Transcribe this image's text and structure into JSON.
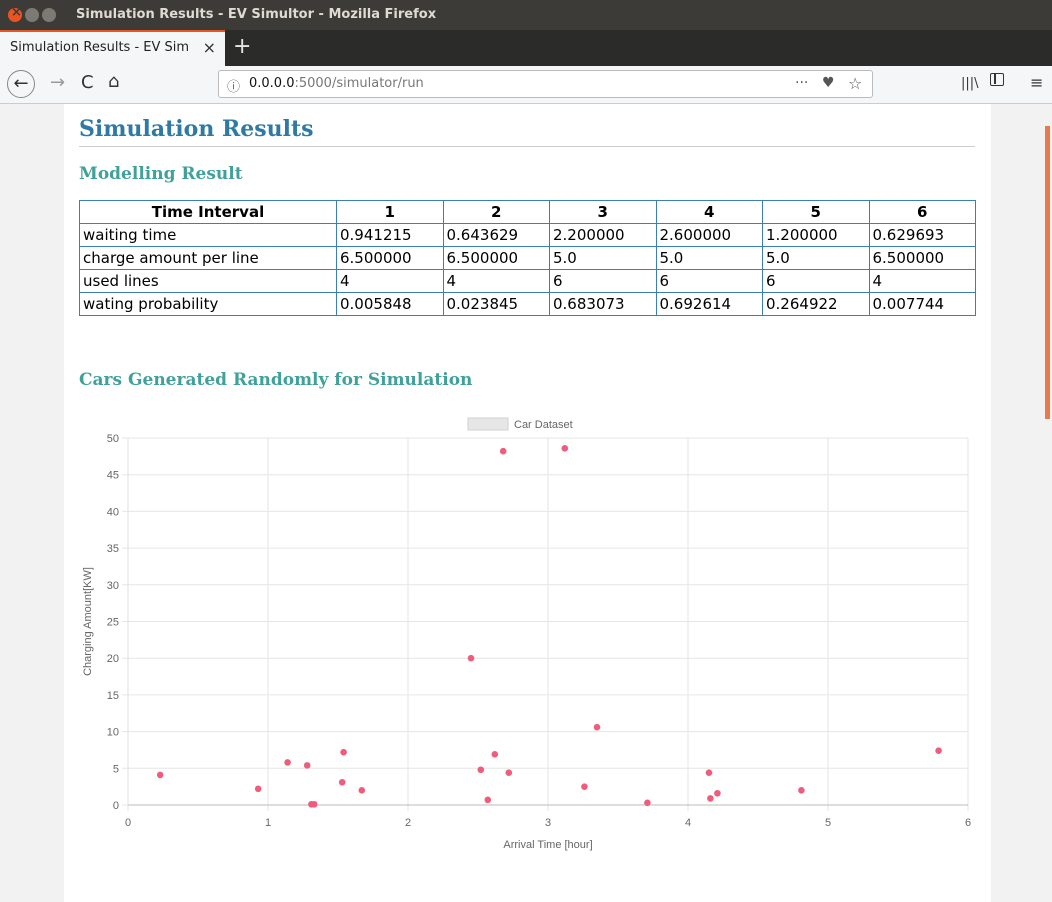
{
  "window": {
    "title": "Simulation Results - EV Simultor - Mozilla Firefox"
  },
  "tab": {
    "title": "Simulation Results - EV Sim",
    "close": "×",
    "new_tab": "+"
  },
  "nav": {
    "back": "←",
    "forward": "→",
    "reload": "C",
    "home": "⌂",
    "url_host": "0.0.0.0",
    "url_path": ":5000/simulator/run",
    "info_icon": "ⓘ",
    "more": "···",
    "pocket": "♥",
    "star": "☆",
    "library": "|||\\",
    "menu": "≡"
  },
  "page": {
    "title": "Simulation Results",
    "modelling_heading": "Modelling Result",
    "cars_heading": "Cars Generated Randomly for Simulation"
  },
  "table": {
    "headers": [
      "Time Interval",
      "1",
      "2",
      "3",
      "4",
      "5",
      "6"
    ],
    "rows": [
      [
        "waiting time",
        "0.941215",
        "0.643629",
        "2.200000",
        "2.600000",
        "1.200000",
        "0.629693"
      ],
      [
        "charge amount per line",
        "6.500000",
        "6.500000",
        "5.0",
        "5.0",
        "5.0",
        "6.500000"
      ],
      [
        "used lines",
        "4",
        "4",
        "6",
        "6",
        "6",
        "4"
      ],
      [
        "wating probability",
        "0.005848",
        "0.023845",
        "0.683073",
        "0.692614",
        "0.264922",
        "0.007744"
      ]
    ]
  },
  "chart_data": {
    "type": "scatter",
    "legend": "Car Dataset",
    "xlabel": "Arrival Time [hour]",
    "ylabel": "Charging Amount[KW]",
    "xlim": [
      0,
      6
    ],
    "ylim": [
      0,
      50
    ],
    "x_ticks": [
      0,
      1,
      2,
      3,
      4,
      5,
      6
    ],
    "y_ticks": [
      0,
      5,
      10,
      15,
      20,
      25,
      30,
      35,
      40,
      45,
      50
    ],
    "grid": true,
    "legend_position": "top",
    "point_color": "#ef5d7d",
    "points": [
      {
        "x": 0.23,
        "y": 4.1
      },
      {
        "x": 0.93,
        "y": 2.2
      },
      {
        "x": 1.14,
        "y": 5.8
      },
      {
        "x": 1.28,
        "y": 5.4
      },
      {
        "x": 1.31,
        "y": 0.1
      },
      {
        "x": 1.33,
        "y": 0.1
      },
      {
        "x": 1.53,
        "y": 3.1
      },
      {
        "x": 1.54,
        "y": 7.2
      },
      {
        "x": 1.67,
        "y": 2.0
      },
      {
        "x": 2.45,
        "y": 20.0
      },
      {
        "x": 2.52,
        "y": 4.8
      },
      {
        "x": 2.57,
        "y": 0.7
      },
      {
        "x": 2.62,
        "y": 6.9
      },
      {
        "x": 2.68,
        "y": 48.2
      },
      {
        "x": 2.72,
        "y": 4.4
      },
      {
        "x": 3.12,
        "y": 48.6
      },
      {
        "x": 3.26,
        "y": 2.5
      },
      {
        "x": 3.35,
        "y": 10.6
      },
      {
        "x": 3.71,
        "y": 0.3
      },
      {
        "x": 4.15,
        "y": 4.4
      },
      {
        "x": 4.16,
        "y": 0.9
      },
      {
        "x": 4.21,
        "y": 1.6
      },
      {
        "x": 4.81,
        "y": 2.0
      },
      {
        "x": 5.79,
        "y": 7.4
      }
    ]
  }
}
